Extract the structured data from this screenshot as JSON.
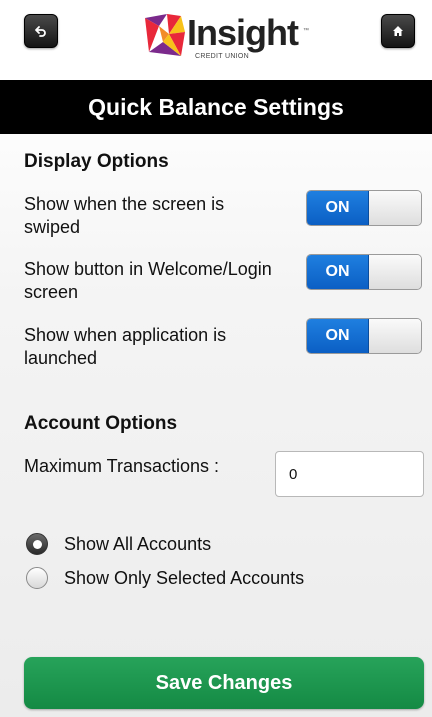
{
  "header": {
    "back_icon": "back-arrow-icon",
    "home_icon": "home-icon",
    "logo": {
      "name": "Insight",
      "subtitle": "CREDIT UNION",
      "tm": "™"
    }
  },
  "title": "Quick Balance Settings",
  "display_options": {
    "heading": "Display Options",
    "items": [
      {
        "label": "Show when the screen is swiped",
        "state": "ON"
      },
      {
        "label": "Show button in Welcome/Login screen",
        "state": "ON"
      },
      {
        "label": "Show when application is launched",
        "state": "ON"
      }
    ]
  },
  "account_options": {
    "heading": "Account Options",
    "max_transactions_label": "Maximum Transactions :",
    "max_transactions_value": "0",
    "radios": [
      {
        "label": "Show All Accounts",
        "checked": true
      },
      {
        "label": "Show Only Selected Accounts",
        "checked": false
      }
    ]
  },
  "save_label": "Save Changes",
  "colors": {
    "toggle_on": "#0b5fc4",
    "save_button": "#1a9550",
    "title_bar": "#000000"
  }
}
